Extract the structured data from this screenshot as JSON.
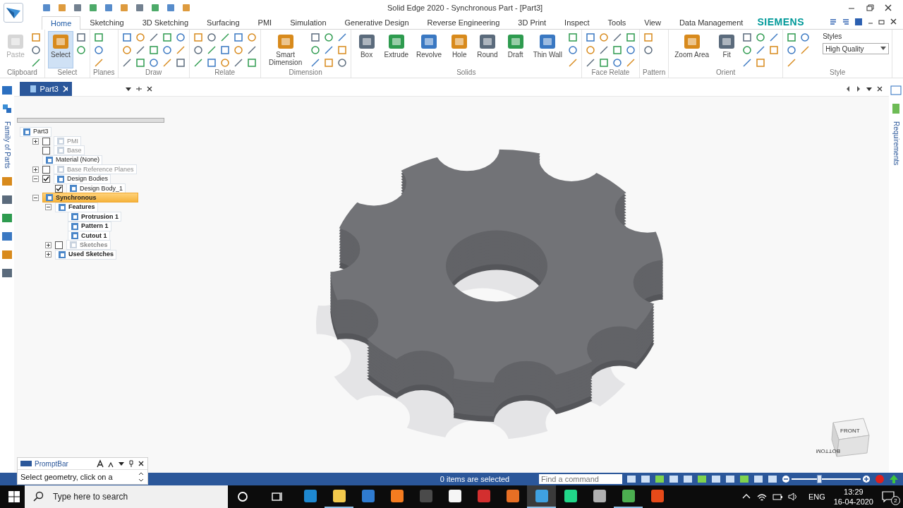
{
  "window": {
    "title": "Solid Edge 2020 - Synchronous Part - [Part3]",
    "brand": "SIEMENS"
  },
  "ribbon_tabs": [
    {
      "label": "Home",
      "selected": true
    },
    {
      "label": "Sketching",
      "selected": false
    },
    {
      "label": "3D Sketching",
      "selected": false
    },
    {
      "label": "Surfacing",
      "selected": false
    },
    {
      "label": "PMI",
      "selected": false
    },
    {
      "label": "Simulation",
      "selected": false
    },
    {
      "label": "Generative Design",
      "selected": false
    },
    {
      "label": "Reverse Engineering",
      "selected": false
    },
    {
      "label": "3D Print",
      "selected": false
    },
    {
      "label": "Inspect",
      "selected": false
    },
    {
      "label": "Tools",
      "selected": false
    },
    {
      "label": "View",
      "selected": false
    },
    {
      "label": "Data Management",
      "selected": false
    }
  ],
  "ribbon_groups": [
    {
      "label": "Clipboard",
      "tools": [
        {
          "label": "Paste",
          "active": false,
          "disabled": true
        }
      ]
    },
    {
      "label": "Select",
      "tools": [
        {
          "label": "Select",
          "active": true,
          "disabled": false
        }
      ]
    },
    {
      "label": "Planes"
    },
    {
      "label": "Draw"
    },
    {
      "label": "Relate"
    },
    {
      "label": "Dimension",
      "tools": [
        {
          "label": "Smart Dimension",
          "active": false,
          "disabled": false
        }
      ]
    },
    {
      "label": "Solids",
      "tools": [
        {
          "label": "Box",
          "active": false,
          "disabled": false
        },
        {
          "label": "Extrude",
          "active": false,
          "disabled": false
        },
        {
          "label": "Revolve",
          "active": false,
          "disabled": false
        },
        {
          "label": "Hole",
          "active": false,
          "disabled": false
        },
        {
          "label": "Round",
          "active": false,
          "disabled": false
        },
        {
          "label": "Draft",
          "active": false,
          "disabled": false
        },
        {
          "label": "Thin Wall",
          "active": false,
          "disabled": false
        }
      ]
    },
    {
      "label": "Face Relate"
    },
    {
      "label": "Pattern"
    },
    {
      "label": "Orient",
      "tools": [
        {
          "label": "Zoom Area",
          "active": false,
          "disabled": false
        },
        {
          "label": "Fit",
          "active": false,
          "disabled": false
        }
      ]
    },
    {
      "label": "Style"
    }
  ],
  "style_box": {
    "label": "Styles",
    "value": "High Quality"
  },
  "document_tab": {
    "title": "Part3"
  },
  "side_panels": {
    "left": "Family of Parts",
    "right": "Requirements"
  },
  "tree": [
    {
      "label": "Part3",
      "selected": false,
      "dimmed": false,
      "bold": false,
      "children": [
        {
          "label": "PMI",
          "selected": false,
          "expanded": false,
          "checked": false,
          "dimmed": true,
          "bold": false
        },
        {
          "label": "Base",
          "selected": false,
          "checked": false,
          "dimmed": true,
          "bold": false
        },
        {
          "label": "Material (None)",
          "selected": false,
          "dimmed": false,
          "bold": false
        },
        {
          "label": "Base Reference Planes",
          "selected": false,
          "expanded": false,
          "checked": false,
          "dimmed": true,
          "bold": false
        },
        {
          "label": "Design Bodies",
          "selected": false,
          "expanded": true,
          "checked": true,
          "dimmed": false,
          "bold": false,
          "children": [
            {
              "label": "Design Body_1",
              "selected": false,
              "checked": true,
              "dimmed": false,
              "bold": false
            }
          ]
        },
        {
          "label": "Synchronous",
          "selected": true,
          "expanded": true,
          "dimmed": false,
          "bold": true,
          "children": [
            {
              "label": "Features",
              "selected": false,
              "expanded": true,
              "dimmed": false,
              "bold": true,
              "children": [
                {
                  "label": "Protrusion 1",
                  "selected": false,
                  "dimmed": false,
                  "bold": true
                },
                {
                  "label": "Pattern 1",
                  "selected": false,
                  "dimmed": false,
                  "bold": true
                },
                {
                  "label": "Cutout 1",
                  "selected": false,
                  "dimmed": false,
                  "bold": true
                }
              ]
            },
            {
              "label": "Sketches",
              "selected": false,
              "expanded": false,
              "checked": false,
              "dimmed": true,
              "bold": true
            },
            {
              "label": "Used Sketches",
              "selected": false,
              "expanded": false,
              "dimmed": false,
              "bold": true
            }
          ]
        }
      ]
    }
  ],
  "view_cube": {
    "front": "FRONT",
    "bottom": "BOTTOM"
  },
  "prompt_bar": {
    "title": "PromptBar",
    "text": "Select geometry, click on a"
  },
  "status_bar": {
    "message": "0 items are selected",
    "command_placeholder": "Find a command",
    "zoom": {
      "level": 0.4
    }
  },
  "taskbar": {
    "search_placeholder": "Type here to search",
    "apps": [
      {
        "color": "#1e88d0",
        "running": false,
        "active": false
      },
      {
        "color": "#f2c94c",
        "running": true,
        "active": false
      },
      {
        "color": "#2f7bd0",
        "running": false,
        "active": false
      },
      {
        "color": "#f57c20",
        "running": false,
        "active": false
      },
      {
        "color": "#4a4a4a",
        "running": false,
        "active": false
      },
      {
        "color": "#f5f5f5",
        "running": false,
        "active": false
      },
      {
        "color": "#d32f2f",
        "running": false,
        "active": false
      },
      {
        "color": "#e76f24",
        "running": false,
        "active": false
      },
      {
        "color": "#3fa1e0",
        "running": true,
        "active": true
      },
      {
        "color": "#21d789",
        "running": false,
        "active": false
      },
      {
        "color": "#b0b0b0",
        "running": false,
        "active": false
      },
      {
        "color": "#4caf50",
        "running": true,
        "active": false
      },
      {
        "color": "#e64a19",
        "running": false,
        "active": false
      }
    ],
    "language": "ENG",
    "time": "13:29",
    "date": "16-04-2020",
    "notifications": "2"
  }
}
